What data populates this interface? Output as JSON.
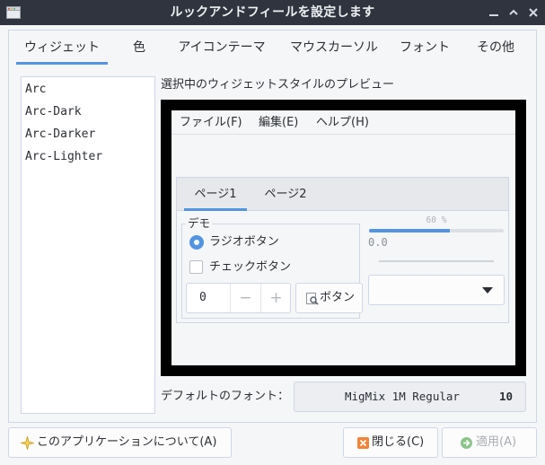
{
  "window": {
    "title": "ルックアンドフィールを設定します"
  },
  "tabs": [
    "ウィジェット",
    "色",
    "アイコンテーマ",
    "マウスカーソル",
    "フォント",
    "その他"
  ],
  "widget_styles": [
    "Arc",
    "Arc-Dark",
    "Arc-Darker",
    "Arc-Lighter"
  ],
  "preview": {
    "label": "選択中のウィジェットスタイルのプレビュー",
    "menus": [
      "ファイル(F)",
      "編集(E)",
      "ヘルプ(H)"
    ],
    "pages": [
      "ページ1",
      "ページ2"
    ],
    "demo_title": "デモ",
    "radio_label": "ラジオボタン",
    "check_label": "チェックボタン",
    "spin_value": "0",
    "spin_minus": "−",
    "spin_plus": "+",
    "button_label": "ボタン",
    "progress_text": "60 %",
    "progress_fraction": 0.6,
    "scale_value": "0.0"
  },
  "font": {
    "label": "デフォルトのフォント：",
    "name": "MigMix 1M Regular",
    "size": "10"
  },
  "buttons": {
    "about": "このアプリケーションについて(A)",
    "close": "閉じる(C)",
    "apply": "適用(A)"
  },
  "colors": {
    "accent": "#5294e2",
    "titlebar": "#2f343f",
    "window_bg": "#f5f6f7",
    "close_icon": "#f08437",
    "apply_icon": "#8bc48a"
  }
}
